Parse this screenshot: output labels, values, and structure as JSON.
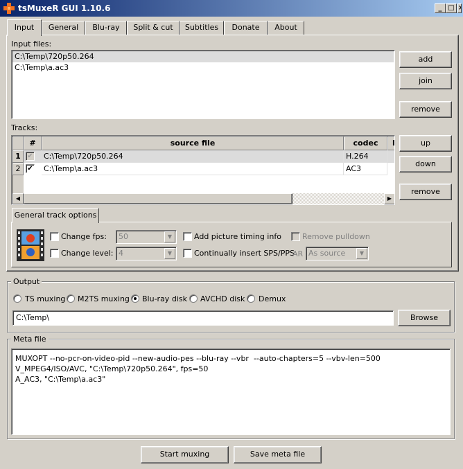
{
  "window": {
    "title": "tsMuxeR GUI 1.10.6",
    "minimize": "_",
    "maximize": "□",
    "close": "×"
  },
  "tabs": [
    "Input",
    "General",
    "Blu-ray",
    "Split & cut",
    "Subtitles",
    "Donate",
    "About"
  ],
  "active_tab": "Input",
  "input_files": {
    "label": "Input files:",
    "files": [
      "C:\\Temp\\720p50.264",
      "C:\\Temp\\a.ac3"
    ],
    "selected_index": 0,
    "buttons": {
      "add": "add",
      "join": "join",
      "remove": "remove"
    }
  },
  "tracks": {
    "label": "Tracks:",
    "columns": [
      "#",
      "source file",
      "codec",
      "language"
    ],
    "rows": [
      {
        "num": "1",
        "checked": true,
        "source": "C:\\Temp\\720p50.264",
        "codec": "H.264"
      },
      {
        "num": "2",
        "checked": true,
        "source": "C:\\Temp\\a.ac3",
        "codec": "AC3"
      }
    ],
    "selected_index": 0,
    "buttons": {
      "up": "up",
      "down": "down",
      "remove": "remove"
    }
  },
  "track_options": {
    "tab_label": "General track options",
    "change_fps": {
      "label": "Change fps:",
      "checked": false,
      "value": "50"
    },
    "change_level": {
      "label": "Change level:",
      "checked": false,
      "value": "4"
    },
    "add_timing": {
      "label": "Add picture timing info",
      "checked": false
    },
    "insert_sps": {
      "label": "Continually insert SPS/PPS",
      "checked": false
    },
    "remove_pulldown": {
      "label": "Remove pulldown",
      "checked": false,
      "enabled": false
    },
    "ar": {
      "label": "AR",
      "value": "As source"
    }
  },
  "output": {
    "label": "Output",
    "modes": [
      {
        "label": "TS muxing",
        "selected": false
      },
      {
        "label": "M2TS muxing",
        "selected": false
      },
      {
        "label": "Blu-ray disk",
        "selected": true
      },
      {
        "label": "AVCHD disk",
        "selected": false
      },
      {
        "label": "Demux",
        "selected": false
      }
    ],
    "path": "C:\\Temp\\",
    "browse": "Browse"
  },
  "meta": {
    "label": "Meta file",
    "lines": [
      "MUXOPT --no-pcr-on-video-pid --new-audio-pes --blu-ray --vbr  --auto-chapters=5 --vbv-len=500",
      "V_MPEG4/ISO/AVC, \"C:\\Temp\\720p50.264\", fps=50",
      "A_AC3, \"C:\\Temp\\a.ac3\""
    ]
  },
  "actions": {
    "start": "Start muxing",
    "save_meta": "Save meta file"
  }
}
